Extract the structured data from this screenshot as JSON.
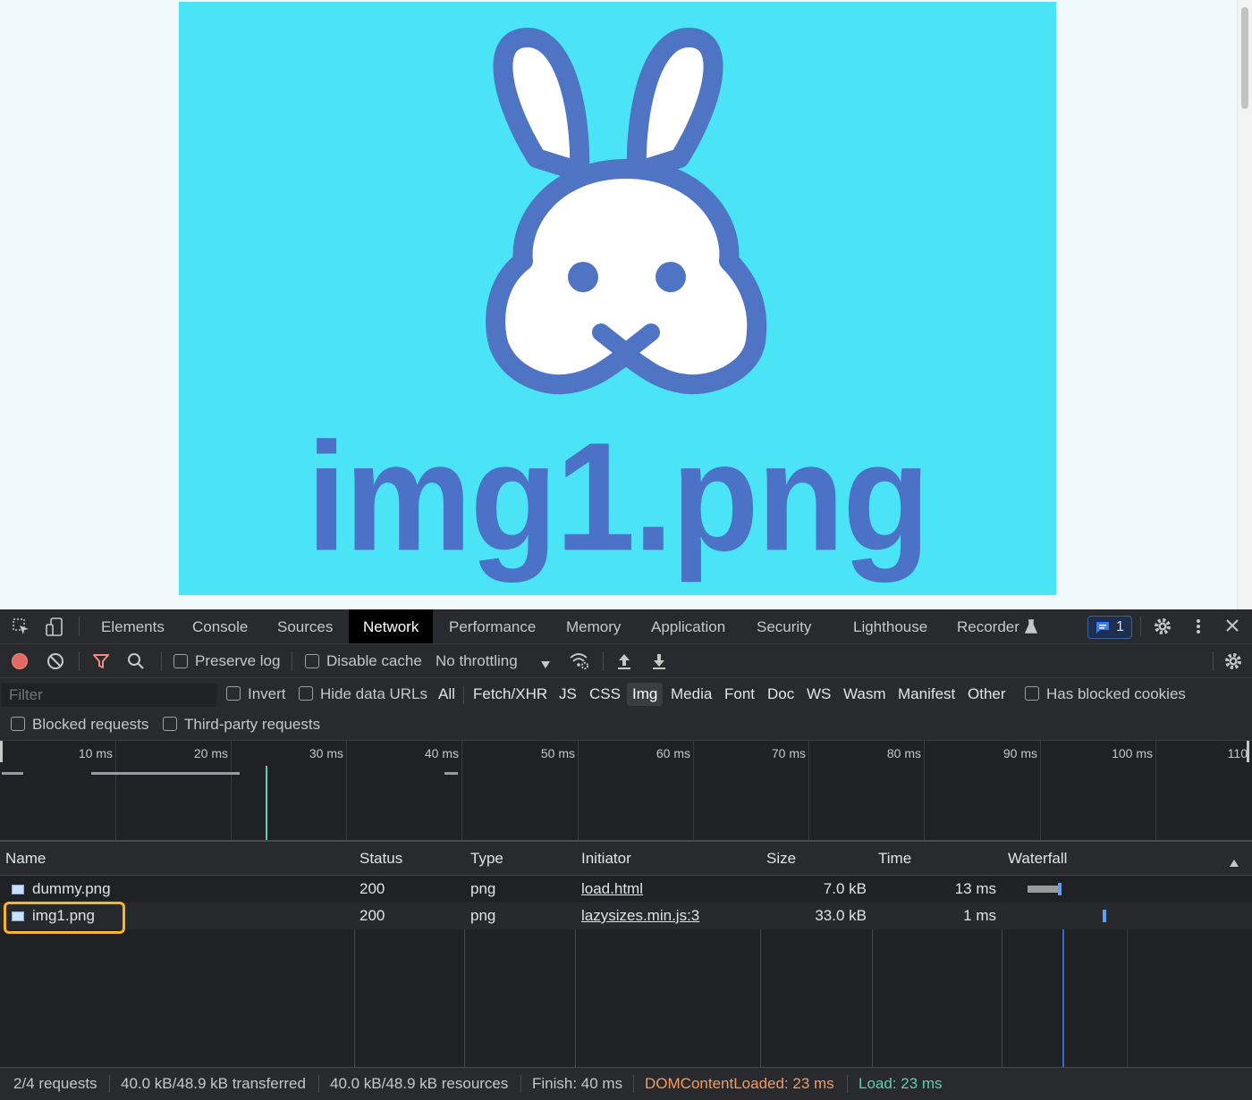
{
  "page": {
    "hero_image_caption": "img1.png"
  },
  "devtools": {
    "tabs": [
      "Elements",
      "Console",
      "Sources",
      "Network",
      "Performance",
      "Memory",
      "Application",
      "Security",
      "Lighthouse",
      "Recorder"
    ],
    "active_tab": "Network",
    "issues_count": "1",
    "toolbar": {
      "preserve_log": "Preserve log",
      "disable_cache": "Disable cache",
      "throttling": "No throttling"
    },
    "filter": {
      "placeholder": "Filter",
      "invert": "Invert",
      "hide_data_urls": "Hide data URLs",
      "types": [
        "All",
        "Fetch/XHR",
        "JS",
        "CSS",
        "Img",
        "Media",
        "Font",
        "Doc",
        "WS",
        "Wasm",
        "Manifest",
        "Other"
      ],
      "active_type": "Img",
      "has_blocked_cookies": "Has blocked cookies",
      "blocked_requests": "Blocked requests",
      "third_party_requests": "Third-party requests"
    },
    "overview_ticks": [
      "10 ms",
      "20 ms",
      "30 ms",
      "40 ms",
      "50 ms",
      "60 ms",
      "70 ms",
      "80 ms",
      "90 ms",
      "100 ms",
      "110"
    ],
    "table": {
      "headers": [
        "Name",
        "Status",
        "Type",
        "Initiator",
        "Size",
        "Time",
        "Waterfall"
      ],
      "rows": [
        {
          "name": "dummy.png",
          "status": "200",
          "type": "png",
          "initiator": "load.html",
          "size": "7.0 kB",
          "time": "13 ms"
        },
        {
          "name": "img1.png",
          "status": "200",
          "type": "png",
          "initiator": "lazysizes.min.js:3",
          "size": "33.0 kB",
          "time": "1 ms"
        }
      ]
    },
    "status": {
      "requests": "2/4 requests",
      "transferred": "40.0 kB/48.9 kB transferred",
      "resources": "40.0 kB/48.9 kB resources",
      "finish": "Finish: 40 ms",
      "dom_content_loaded": "DOMContentLoaded: 23 ms",
      "load": "Load: 23 ms"
    },
    "colors": {
      "dcl": "#f29c62",
      "load": "#5cd0b3",
      "highlight": "#f5b62a"
    }
  }
}
